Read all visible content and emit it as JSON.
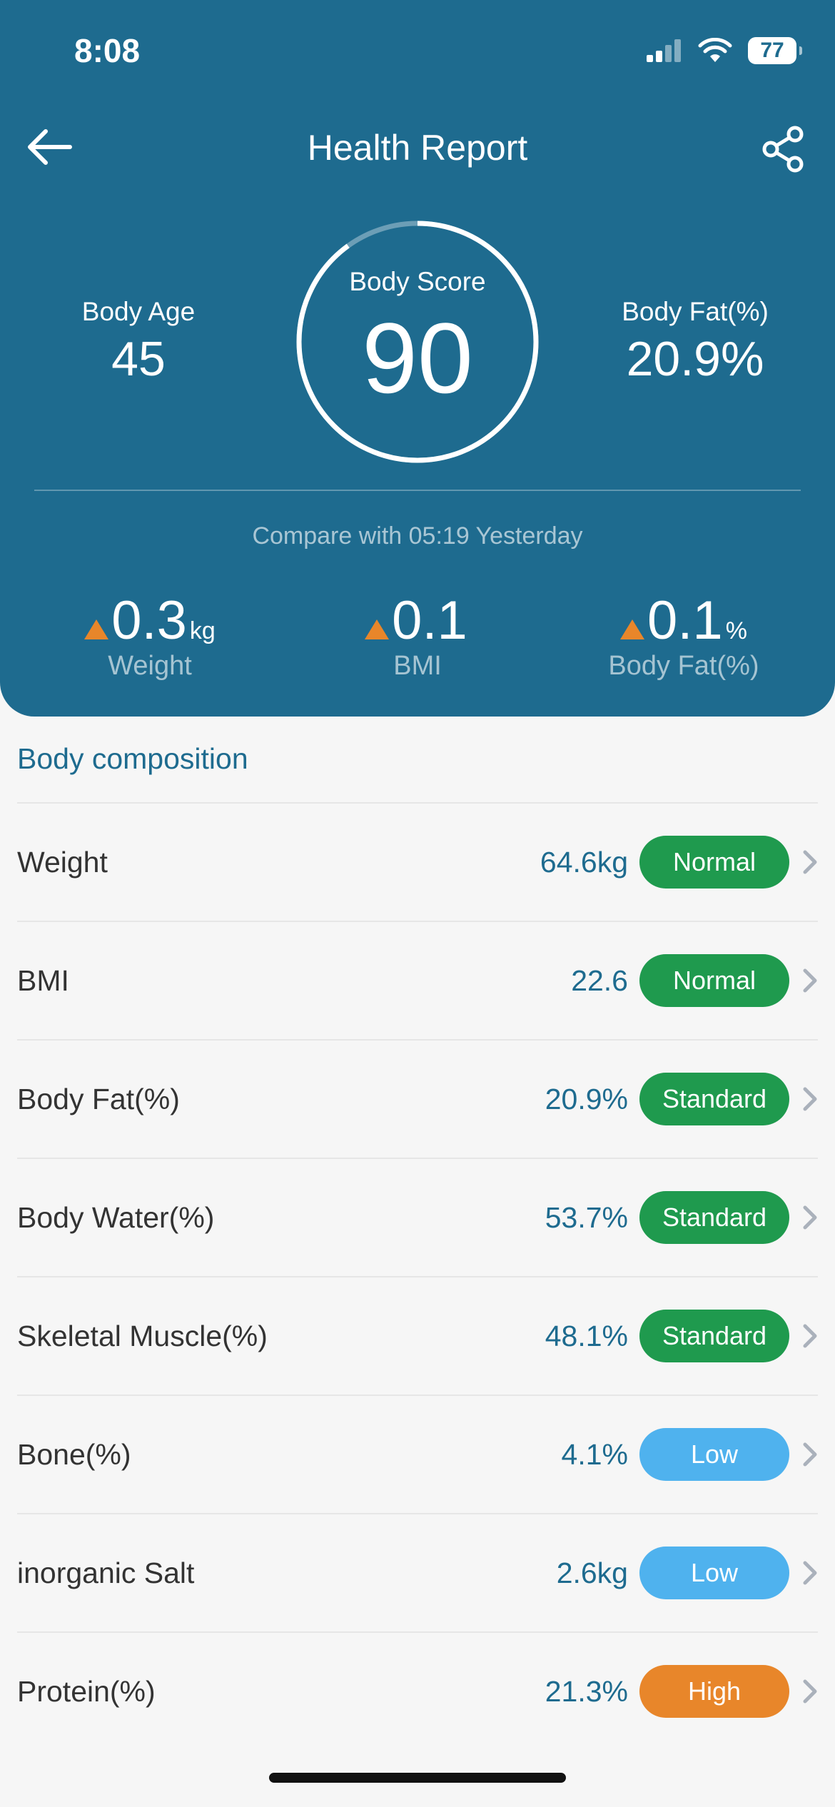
{
  "status_bar": {
    "time": "8:08",
    "battery": "77"
  },
  "header": {
    "title": "Health Report"
  },
  "summary": {
    "body_age_label": "Body Age",
    "body_age_value": "45",
    "score_label": "Body Score",
    "score_value": "90",
    "body_fat_label": "Body Fat(%)",
    "body_fat_value": "20.9%",
    "compare_text": "Compare with 05:19 Yesterday"
  },
  "deltas": [
    {
      "value": "0.3",
      "unit": "kg",
      "label": "Weight",
      "direction": "up"
    },
    {
      "value": "0.1",
      "unit": "",
      "label": "BMI",
      "direction": "up"
    },
    {
      "value": "0.1",
      "unit": "%",
      "label": "Body Fat(%)",
      "direction": "up"
    }
  ],
  "body_composition": {
    "title": "Body composition",
    "items": [
      {
        "name": "Weight",
        "value": "64.6kg",
        "status": "Normal",
        "color": "#1f9a4e"
      },
      {
        "name": "BMI",
        "value": "22.6",
        "status": "Normal",
        "color": "#1f9a4e"
      },
      {
        "name": "Body Fat(%)",
        "value": "20.9%",
        "status": "Standard",
        "color": "#1f9a4e"
      },
      {
        "name": "Body Water(%)",
        "value": "53.7%",
        "status": "Standard",
        "color": "#1f9a4e"
      },
      {
        "name": "Skeletal Muscle(%)",
        "value": "48.1%",
        "status": "Standard",
        "color": "#1f9a4e"
      },
      {
        "name": "Bone(%)",
        "value": "4.1%",
        "status": "Low",
        "color": "#4fb2ee"
      },
      {
        "name": "inorganic Salt",
        "value": "2.6kg",
        "status": "Low",
        "color": "#4fb2ee"
      },
      {
        "name": "Protein(%)",
        "value": "21.3%",
        "status": "High",
        "color": "#e8862a"
      }
    ]
  },
  "colors": {
    "header_bg": "#1e6b8f",
    "accent": "#1e6b8f",
    "up_arrow": "#e8862a"
  }
}
